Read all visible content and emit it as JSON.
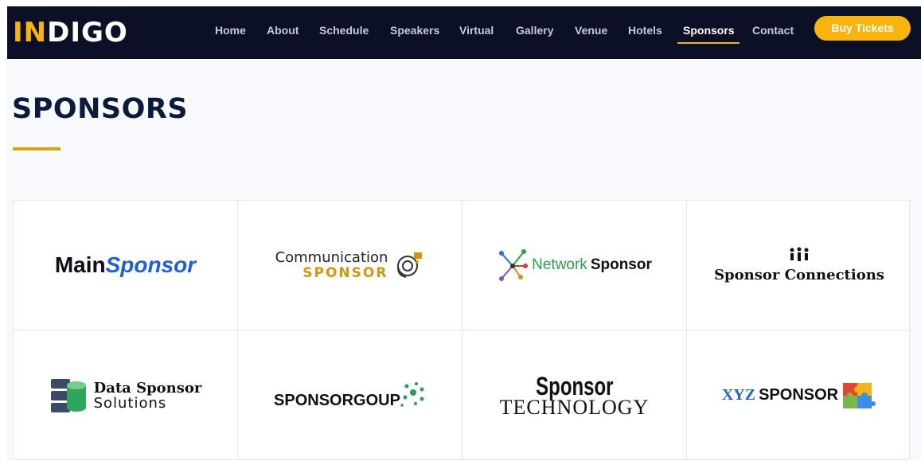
{
  "brand": {
    "accent_part": "IN",
    "rest": "DIGO"
  },
  "nav": {
    "items": [
      {
        "label": "Home"
      },
      {
        "label": "About"
      },
      {
        "label": "Schedule"
      },
      {
        "label": "Speakers"
      },
      {
        "label": "Virtual"
      },
      {
        "label": "Gallery"
      },
      {
        "label": "Venue"
      },
      {
        "label": "Hotels"
      },
      {
        "label": "Sponsors",
        "active": true
      },
      {
        "label": "Contact"
      }
    ],
    "cta_label": "Buy Tickets"
  },
  "page": {
    "title": "SPONSORS"
  },
  "sponsors": [
    {
      "name_a": "Main",
      "name_b": "Sponsor"
    },
    {
      "name_a": "Communication",
      "name_b": "SPONSOR"
    },
    {
      "name_a": "Network",
      "name_b": "Sponsor"
    },
    {
      "name_a": "Sponsor Connections"
    },
    {
      "name_a": "Data Sponsor",
      "name_b": "Solutions"
    },
    {
      "name_a": "SPONSORGOUP"
    },
    {
      "name_a": "Sponsor",
      "name_b": "TECHNOLOGY"
    },
    {
      "name_a": "XYZ",
      "name_b": "SPONSOR"
    }
  ],
  "colors": {
    "nav_bg": "#0b1026",
    "accent": "#f6b40c",
    "title": "#0b1a3d",
    "border": "#e3e6f2"
  },
  "icons": [
    "headset-chat-icon",
    "network-nodes-icon",
    "people-network-icon",
    "database-stack-icon",
    "dots-burst-icon",
    "puzzle-icon"
  ]
}
